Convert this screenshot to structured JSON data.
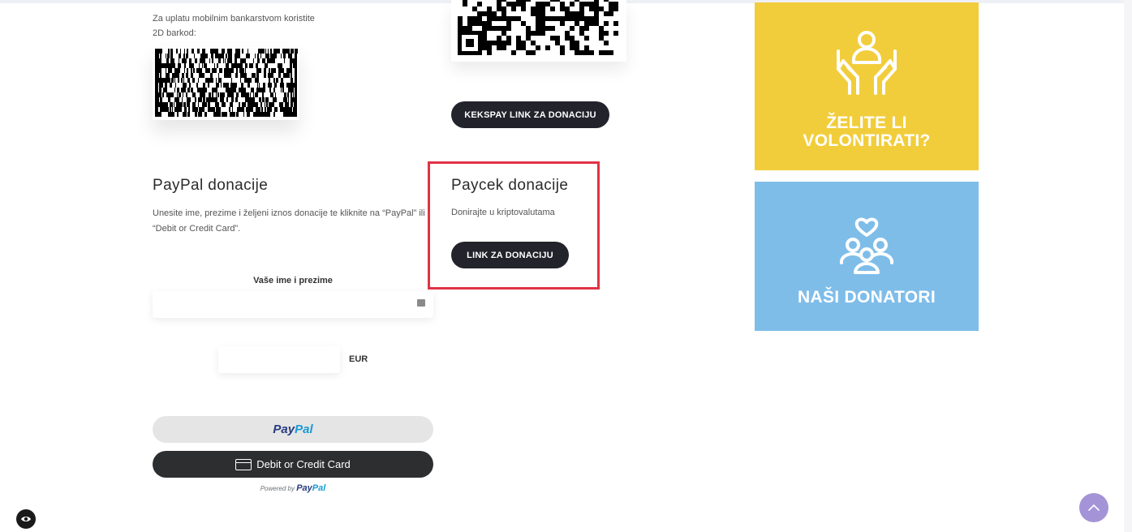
{
  "mobile_banking": {
    "text": "Za uplatu mobilnim bankarstvom koristite 2D barkod:"
  },
  "kekspay": {
    "button_label": "KEKSPAY LINK ZA DONACIJU"
  },
  "paypal_section": {
    "title": "PayPal donacije",
    "description": "Unesite ime, prezime i željeni iznos donacije te kliknite na “PayPal” ili “Debit or Credit Card”.",
    "name_label": "Vaše ime i prezime",
    "name_value": "",
    "amount_value": "",
    "currency": "EUR",
    "paypal_button": {
      "pay": "Pay",
      "pal": "Pal"
    },
    "card_button_label": "Debit or Credit Card",
    "powered_by": "Powered by",
    "powered_brand": {
      "pay": "Pay",
      "pal": "Pal"
    }
  },
  "paycek_section": {
    "title": "Paycek donacije",
    "description": "Donirajte u kriptovalutama",
    "button_label": "LINK ZA DONACIJU"
  },
  "tiles": {
    "volunteer": {
      "label_line1": "ŽELITE LI",
      "label_line2": "VOLONTIRATI?",
      "icon": "hands-person-icon",
      "color": "#f2cd3b"
    },
    "donors": {
      "label": "NAŠI DONATORI",
      "icon": "people-heart-icon",
      "color": "#7fbde9"
    }
  },
  "colors": {
    "highlight": "#e03345",
    "dark_button": "#22232b",
    "scroll_top": "#a493d6"
  },
  "icons": {
    "accessibility": "eye-icon",
    "scroll_top": "chevron-up-icon",
    "card": "credit-card-icon"
  }
}
